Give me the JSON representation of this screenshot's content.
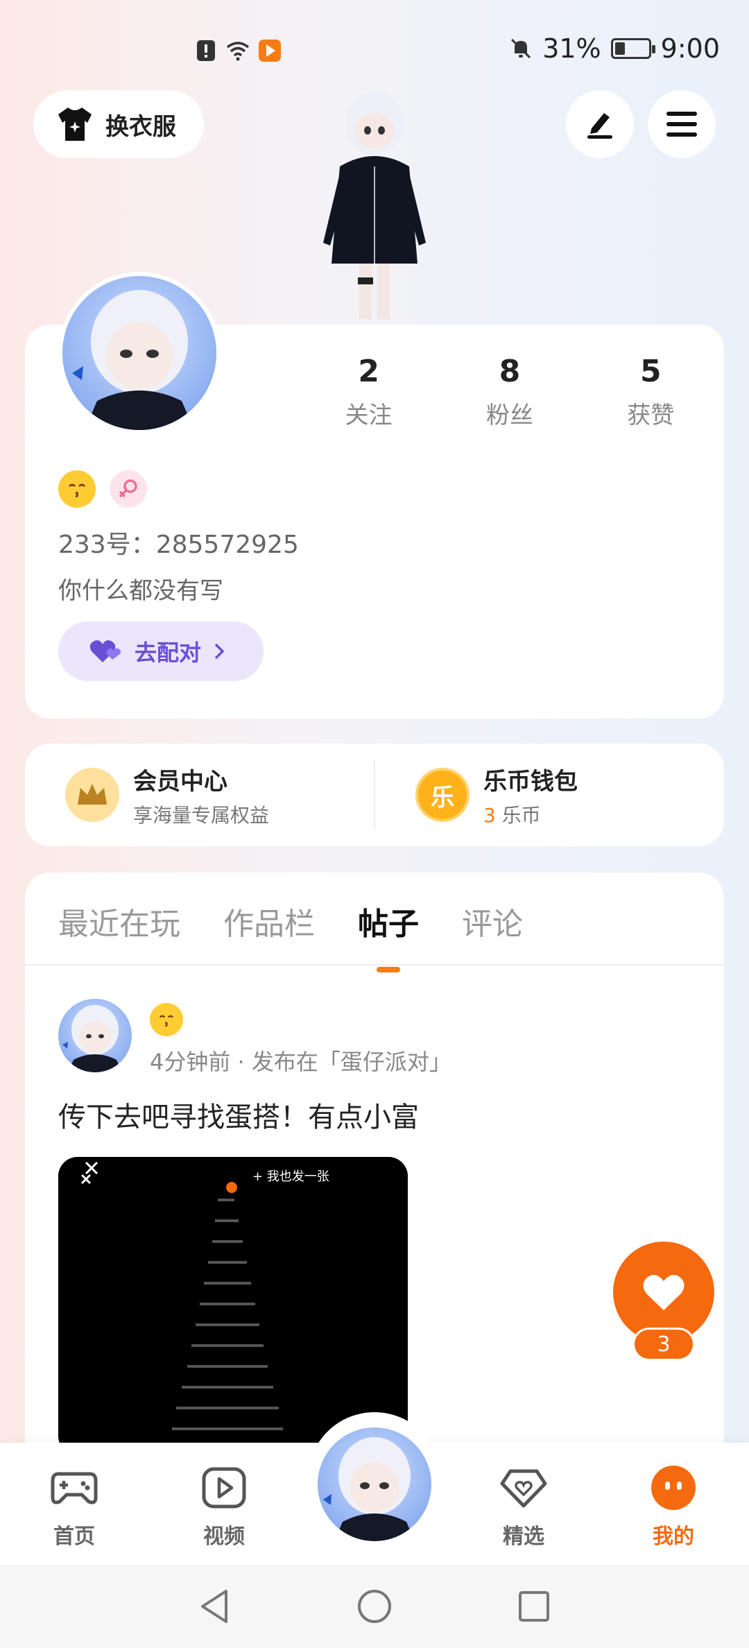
{
  "status_bar": {
    "battery_percent": "31%",
    "battery_level": 0.31,
    "time": "9:00"
  },
  "header": {
    "outfit_label": "换衣服"
  },
  "profile": {
    "stats": [
      {
        "value": "2",
        "label": "关注"
      },
      {
        "value": "8",
        "label": "粉丝"
      },
      {
        "value": "5",
        "label": "获赞"
      }
    ],
    "uid_line": "233号：285572925",
    "bio": "你什么都没有写",
    "match_label": "去配对"
  },
  "wallet": {
    "vip_title": "会员中心",
    "vip_sub": "享海量专属权益",
    "coin_title": "乐币钱包",
    "coin_count": "3",
    "coin_unit": "乐币",
    "coin_glyph": "乐"
  },
  "tabs": [
    "最近在玩",
    "作品栏",
    "帖子",
    "评论"
  ],
  "active_tab": "帖子",
  "post": {
    "meta": "4分钟前 · 发布在「蛋仔派对」",
    "text": "传下去吧寻找蛋搭！有点小富",
    "image_overlay": "+ 我也发一张"
  },
  "like": {
    "count": "3"
  },
  "bottom_nav": [
    {
      "label": "首页",
      "icon": "gamepad-icon"
    },
    {
      "label": "视频",
      "icon": "play-icon"
    },
    {
      "label": "精选",
      "icon": "heart-diamond-icon"
    },
    {
      "label": "我的",
      "icon": "mine-icon"
    }
  ],
  "colors": {
    "accent": "#f56a0f",
    "match": "#6a4fd6"
  }
}
